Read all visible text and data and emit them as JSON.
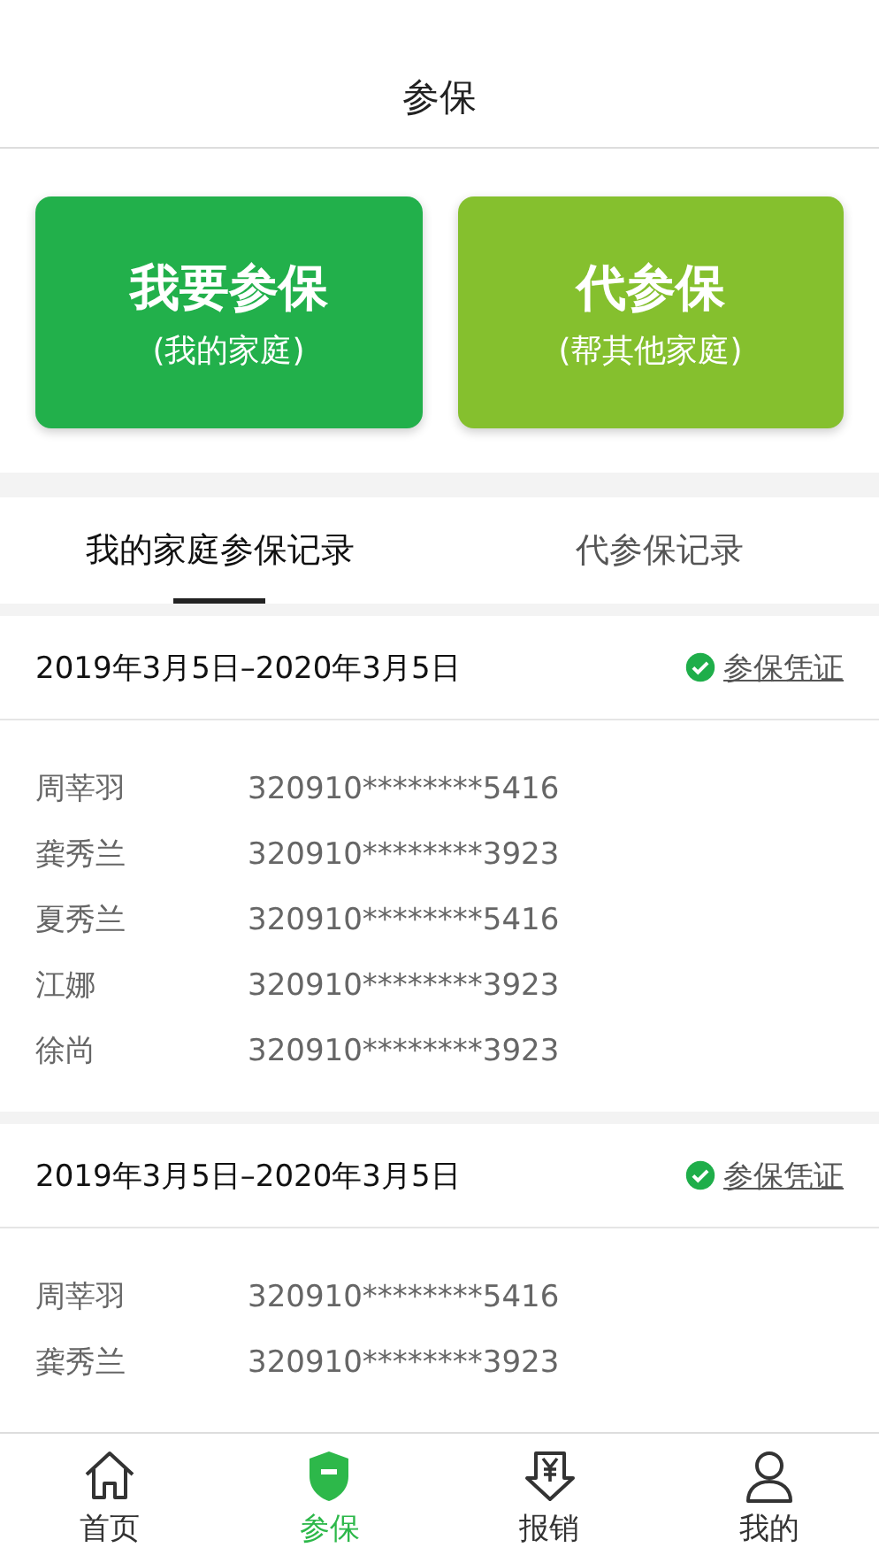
{
  "header": {
    "title": "参保"
  },
  "actions": [
    {
      "kind": "self",
      "title": "我要参保",
      "subtitle": "(我的家庭)"
    },
    {
      "kind": "proxy",
      "title": "代参保",
      "subtitle": "(帮其他家庭)"
    }
  ],
  "tabs": [
    {
      "label": "我的家庭参保记录",
      "selected": true
    },
    {
      "label": "代参保记录",
      "selected": false
    }
  ],
  "records": [
    {
      "period": "2019年3月5日–2020年3月5日",
      "voucher": "参保凭证",
      "members": [
        {
          "name": "周莘羽",
          "id": "320910********5416"
        },
        {
          "name": "龚秀兰",
          "id": "320910********3923"
        },
        {
          "name": "夏秀兰",
          "id": "320910********5416"
        },
        {
          "name": "江娜",
          "id": "320910********3923"
        },
        {
          "name": "徐尚",
          "id": "320910********3923"
        }
      ]
    },
    {
      "period": "2019年3月5日–2020年3月5日",
      "voucher": "参保凭证",
      "members": [
        {
          "name": "周莘羽",
          "id": "320910********5416"
        },
        {
          "name": "龚秀兰",
          "id": "320910********3923"
        }
      ]
    }
  ],
  "nav": [
    {
      "kind": "home",
      "label": "首页",
      "selected": false
    },
    {
      "kind": "shield",
      "label": "参保",
      "selected": true
    },
    {
      "kind": "receipt",
      "label": "报销",
      "selected": false
    },
    {
      "kind": "user",
      "label": "我的",
      "selected": false
    }
  ]
}
